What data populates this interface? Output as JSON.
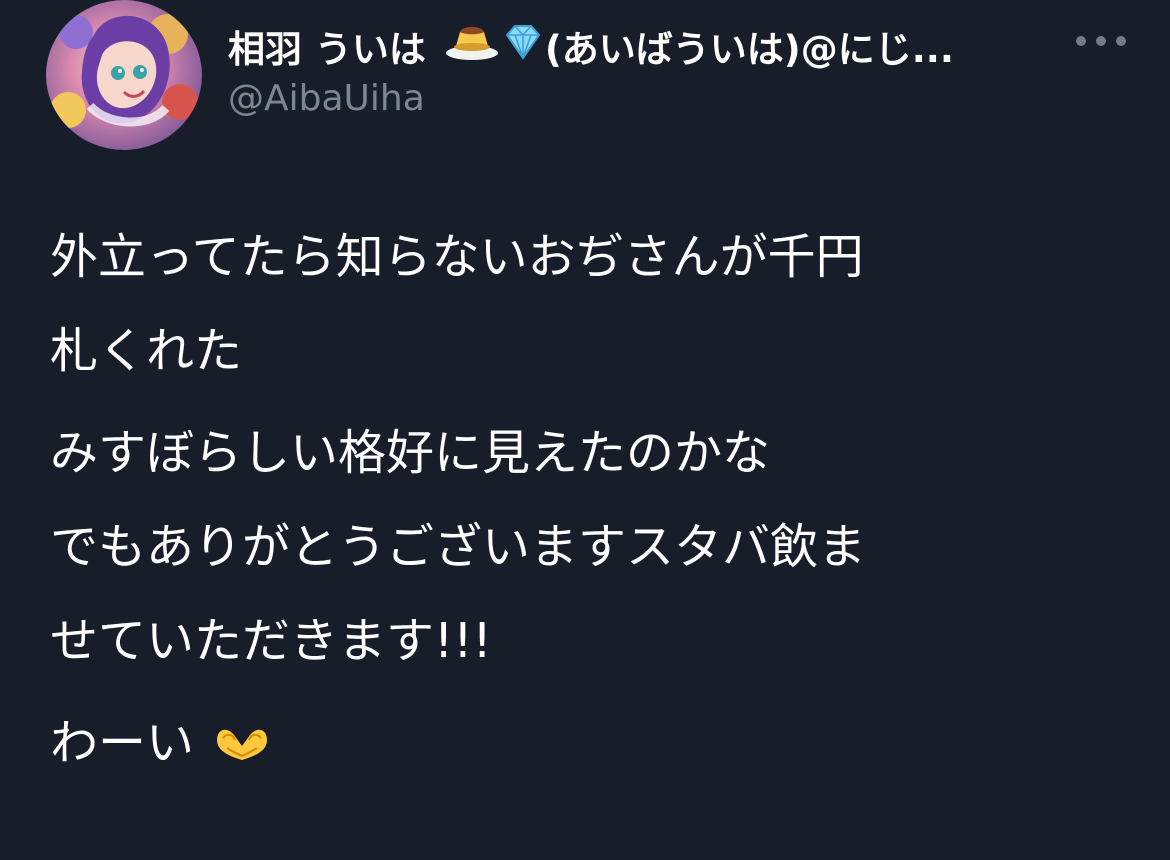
{
  "author": {
    "display_name_prefix": "相羽 ういは",
    "display_name_suffix": "(あいばういは)@にじ...",
    "handle": "@AibaUiha",
    "name_emojis": [
      "pudding-icon",
      "diamond-icon"
    ]
  },
  "tweet": {
    "paragraphs": [
      {
        "lines": [
          "外立ってたら知らないおぢさんが千円",
          "札くれた"
        ]
      },
      {
        "lines": [
          "みすぼらしい格好に見えたのかな",
          "でもありがとうございますスタバ飲ま",
          "せていただきます!!!"
        ]
      },
      {
        "lines": [
          "わーい"
        ]
      }
    ]
  },
  "icons": {
    "more": "more-icon",
    "heart_hands": "heart-hands-icon"
  },
  "colors": {
    "background": "#171d29",
    "text": "#ffffff",
    "muted": "#7d8794"
  }
}
